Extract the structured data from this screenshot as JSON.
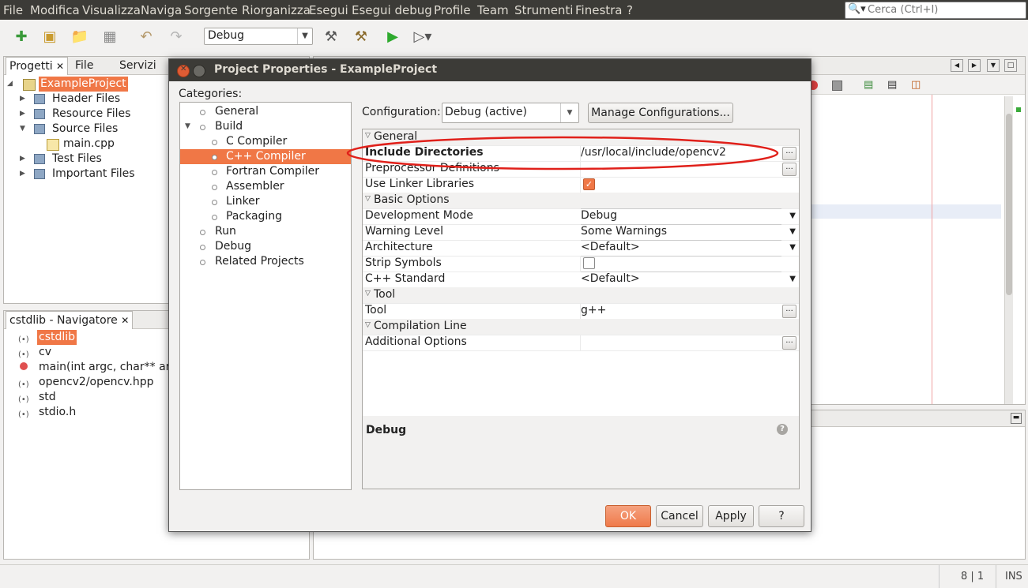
{
  "menubar": {
    "items": [
      "File",
      "Modifica",
      "Visualizza",
      "Naviga",
      "Sorgente",
      "Riorganizza",
      "Esegui",
      "Esegui debug",
      "Profile",
      "Team",
      "Strumenti",
      "Finestra",
      "?"
    ],
    "search_placeholder": "Cerca (Ctrl+I)"
  },
  "toolbar": {
    "configuration": "Debug"
  },
  "projects_panel": {
    "tabs": [
      "Progetti",
      "File",
      "Servizi"
    ],
    "active_tab": "Progetti",
    "tree": [
      {
        "label": "ExampleProject",
        "level": 0,
        "selected": true
      },
      {
        "label": "Header Files",
        "level": 1
      },
      {
        "label": "Resource Files",
        "level": 1
      },
      {
        "label": "Source Files",
        "level": 1
      },
      {
        "label": "main.cpp",
        "level": 2
      },
      {
        "label": "Test Files",
        "level": 1
      },
      {
        "label": "Important Files",
        "level": 1
      }
    ]
  },
  "navigator_panel": {
    "title": "cstdlib - Navigatore",
    "items": [
      {
        "label": "cstdlib",
        "selected": true
      },
      {
        "label": "cv"
      },
      {
        "label": "main(int argc, char** arg"
      },
      {
        "label": "opencv2/opencv.hpp"
      },
      {
        "label": "std"
      },
      {
        "label": "stdio.h"
      }
    ]
  },
  "dialog": {
    "title": "Project Properties - ExampleProject",
    "categories_label": "Categories:",
    "categories": [
      {
        "label": "General",
        "level": 0
      },
      {
        "label": "Build",
        "level": 0,
        "expanded": true
      },
      {
        "label": "C Compiler",
        "level": 1
      },
      {
        "label": "C++ Compiler",
        "level": 1,
        "selected": true
      },
      {
        "label": "Fortran Compiler",
        "level": 1
      },
      {
        "label": "Assembler",
        "level": 1
      },
      {
        "label": "Linker",
        "level": 1
      },
      {
        "label": "Packaging",
        "level": 1
      },
      {
        "label": "Run",
        "level": 0
      },
      {
        "label": "Debug",
        "level": 0
      },
      {
        "label": "Related Projects",
        "level": 0
      }
    ],
    "configuration_label": "Configuration:",
    "configuration_value": "Debug (active)",
    "manage_button": "Manage Configurations...",
    "groups": {
      "general": "General",
      "basic": "Basic Options",
      "tool": "Tool",
      "compilation": "Compilation Line"
    },
    "props": {
      "include_dirs": {
        "key": "Include Directories",
        "value": "/usr/local/include/opencv2"
      },
      "preproc": {
        "key": "Preprocessor Definitions",
        "value": ""
      },
      "linker_libs": {
        "key": "Use Linker Libraries",
        "checked": true
      },
      "dev_mode": {
        "key": "Development Mode",
        "value": "Debug"
      },
      "warning": {
        "key": "Warning Level",
        "value": "Some Warnings"
      },
      "arch": {
        "key": "Architecture",
        "value": "<Default>"
      },
      "strip": {
        "key": "Strip Symbols",
        "checked": false
      },
      "cpp_std": {
        "key": "C++ Standard",
        "value": "<Default>"
      },
      "tool": {
        "key": "Tool",
        "value": "g++"
      },
      "additional": {
        "key": "Additional Options",
        "value": ""
      }
    },
    "description_title": "Debug",
    "buttons": {
      "ok": "OK",
      "cancel": "Cancel",
      "apply": "Apply",
      "help": "?"
    }
  },
  "statusbar": {
    "position": "8 | 1",
    "mode": "INS"
  },
  "colors": {
    "accent": "#f07746",
    "highlight_ellipse": "#e0201a",
    "titlebar": "#3c3b37"
  }
}
